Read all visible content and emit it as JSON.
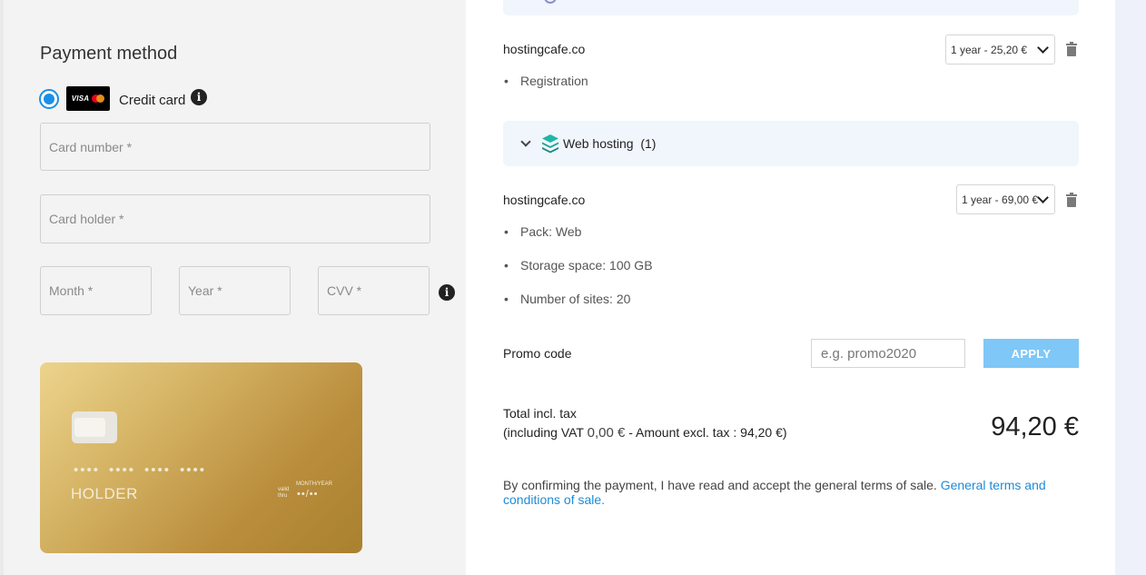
{
  "payment": {
    "title": "Payment method",
    "method_label": "Credit card",
    "logo_text": "VISA",
    "card_number_placeholder": "Card number *",
    "card_holder_placeholder": "Card holder *",
    "month_placeholder": "Month *",
    "year_placeholder": "Year *",
    "cvv_placeholder": "CVV *"
  },
  "card_preview": {
    "number_groups": [
      "••••",
      "••••",
      "••••",
      "••••"
    ],
    "holder": "HOLDER",
    "valid_thru": "valid thru",
    "month_year": "MONTH/YEAR",
    "expiry": "••/••"
  },
  "cart": {
    "domain_item": {
      "domain": "hostingcafe.co",
      "duration": "1 year - 25,20 €",
      "details": [
        "Registration"
      ]
    },
    "web_hosting_section": {
      "label": "Web hosting",
      "count": "(1)"
    },
    "hosting_item": {
      "domain": "hostingcafe.co",
      "duration": "1 year - 69,00 €",
      "details": [
        "Pack: Web",
        "Storage space: 100 GB",
        "Number of sites: 20"
      ]
    }
  },
  "promo": {
    "label": "Promo code",
    "placeholder": "e.g. promo2020",
    "apply_label": "APPLY"
  },
  "total": {
    "label": "Total incl. tax",
    "vat_prefix": "(including VAT ",
    "vat_amount": "0,00 €",
    "vat_suffix": " - Amount excl. tax : 94,20 €)",
    "amount": "94,20 €"
  },
  "terms": {
    "text": "By confirming the payment, I have read and accept the general terms of sale. ",
    "link": "General terms and conditions of sale."
  },
  "colors": {
    "accent": "#1890e8",
    "apply_button": "#7fc7f6",
    "link": "#1e8bd8",
    "card_gold": "#c9a24f"
  }
}
